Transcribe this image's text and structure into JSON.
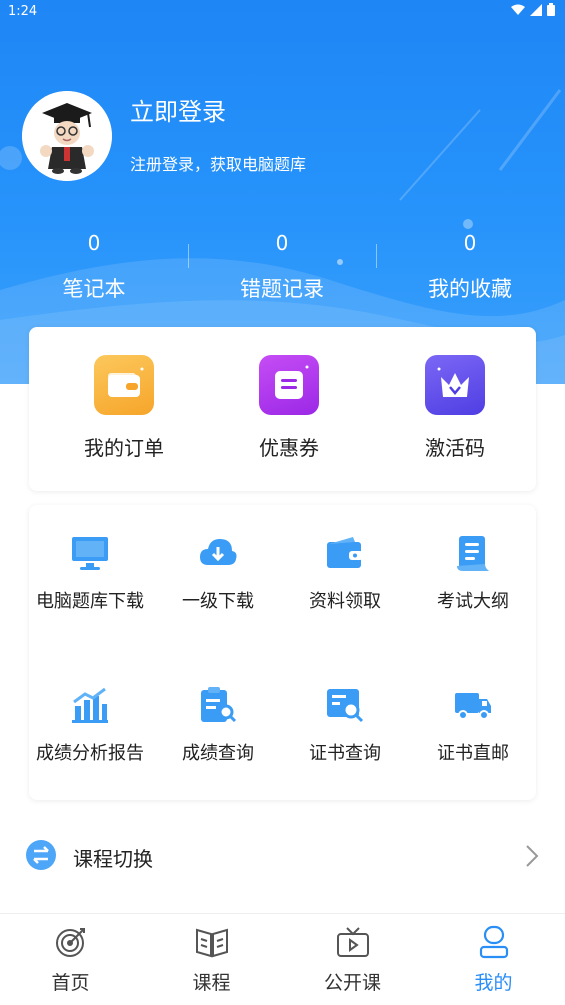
{
  "status_bar": {
    "time": "1:24"
  },
  "profile": {
    "title": "立即登录",
    "subtitle": "注册登录，获取电脑题库"
  },
  "stats": [
    {
      "value": "0",
      "label": "笔记本"
    },
    {
      "value": "0",
      "label": "错题记录"
    },
    {
      "value": "0",
      "label": "我的收藏"
    }
  ],
  "quick_actions": [
    {
      "label": "我的订单",
      "icon": "wallet-icon",
      "color": "#f9b43a"
    },
    {
      "label": "优惠券",
      "icon": "coupon-icon",
      "color": "#b13af0"
    },
    {
      "label": "激活码",
      "icon": "crown-icon",
      "color": "#6a4ff0"
    }
  ],
  "tools": [
    {
      "label": "电脑题库下载",
      "icon": "monitor-icon"
    },
    {
      "label": "一级下载",
      "icon": "cloud-download-icon"
    },
    {
      "label": "资料领取",
      "icon": "wallet-icon"
    },
    {
      "label": "考试大纲",
      "icon": "scroll-icon"
    },
    {
      "label": "成绩分析报告",
      "icon": "bar-chart-icon"
    },
    {
      "label": "成绩查询",
      "icon": "clipboard-search-icon"
    },
    {
      "label": "证书查询",
      "icon": "certificate-search-icon"
    },
    {
      "label": "证书直邮",
      "icon": "truck-icon"
    }
  ],
  "course_switch": {
    "label": "课程切换"
  },
  "bottom_nav": [
    {
      "label": "首页",
      "icon": "target-icon"
    },
    {
      "label": "课程",
      "icon": "book-icon"
    },
    {
      "label": "公开课",
      "icon": "tv-icon"
    },
    {
      "label": "我的",
      "icon": "user-icon",
      "active": true
    }
  ],
  "colors": {
    "primary": "#2690fa",
    "icon_blue": "#3a9cf5",
    "active_tab": "#2a8ef7"
  }
}
